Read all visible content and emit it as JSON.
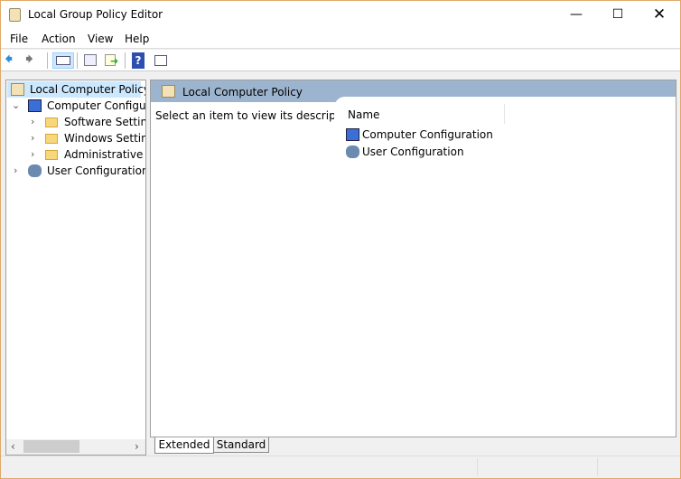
{
  "window": {
    "title": "Local Group Policy Editor",
    "controls": [
      "minimize",
      "maximize",
      "close"
    ]
  },
  "menu": [
    "File",
    "Action",
    "View",
    "Help"
  ],
  "toolbar": {
    "icons": [
      "back-icon",
      "forward-icon",
      "show-hide-tree-icon",
      "properties-icon",
      "export-list-icon",
      "help-icon",
      "show-hide-action-pane-icon"
    ]
  },
  "tree": {
    "root": "Local Computer Policy",
    "computer": "Computer Configuration",
    "children": [
      "Software Settings",
      "Windows Settings",
      "Administrative Templates"
    ],
    "user": "User Configuration"
  },
  "details": {
    "header": "Local Computer Policy",
    "description": "Select an item to view its description.",
    "column": "Name",
    "items": [
      "Computer Configuration",
      "User Configuration"
    ]
  },
  "tabs": [
    "Extended",
    "Standard"
  ],
  "colors": {
    "header": "#9db4cf",
    "selection": "#cce8ff",
    "border": "#e0a868"
  }
}
